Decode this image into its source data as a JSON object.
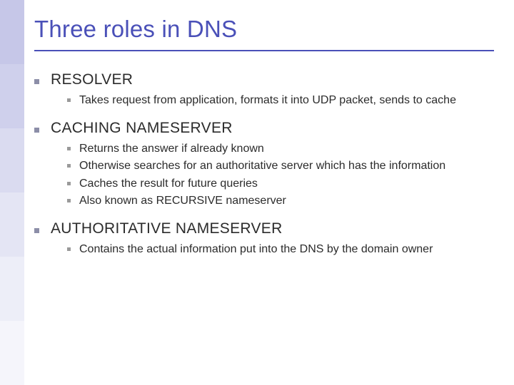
{
  "title": "Three roles in DNS",
  "sections": [
    {
      "heading": "RESOLVER",
      "items": [
        "Takes request from application, formats it into UDP packet, sends to cache"
      ]
    },
    {
      "heading": "CACHING NAMESERVER",
      "items": [
        "Returns the answer if already known",
        "Otherwise searches for an authoritative server which has the information",
        "Caches the result for future queries",
        "Also known as RECURSIVE nameserver"
      ]
    },
    {
      "heading": "AUTHORITATIVE NAMESERVER",
      "items": [
        "Contains the actual information put into the DNS by the domain owner"
      ]
    }
  ]
}
